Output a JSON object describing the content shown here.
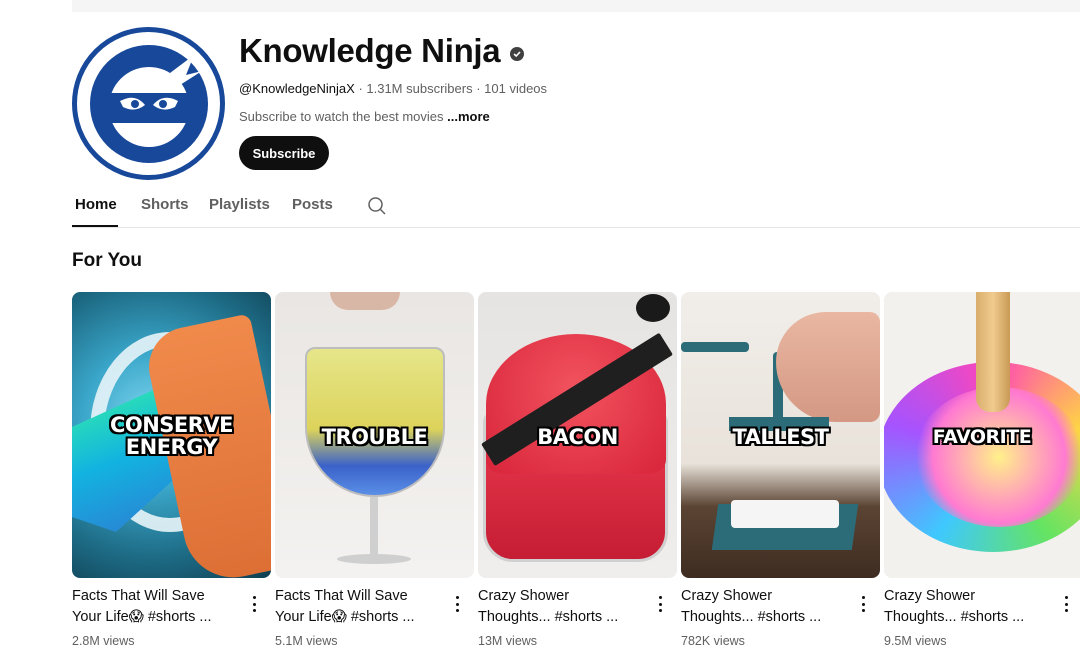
{
  "channel": {
    "name": "Knowledge Ninja",
    "handle": "@KnowledgeNinjaX",
    "stats": " · 1.31M subscribers · 101 videos",
    "description": "Subscribe to watch the best movies ",
    "more_label": "...more",
    "subscribe_label": "Subscribe",
    "brand_color": "#17489a",
    "verified_icon": "verified-check-icon"
  },
  "tabs": [
    {
      "label": "Home",
      "active": true
    },
    {
      "label": "Shorts",
      "active": false
    },
    {
      "label": "Playlists",
      "active": false
    },
    {
      "label": "Posts",
      "active": false
    }
  ],
  "section": {
    "title": "For You"
  },
  "videos": [
    {
      "thumb_text": "CONSERVE ENERGY",
      "title_line1": "Facts That Will Save",
      "title_line2": "Your Life😱 #shorts ...",
      "views": "2.8M views"
    },
    {
      "thumb_text": "TROUBLE",
      "title_line1": "Facts That Will Save",
      "title_line2": "Your Life😱 #shorts ...",
      "views": "5.1M views"
    },
    {
      "thumb_text": "BACON",
      "title_line1": "Crazy Shower",
      "title_line2": "Thoughts... #shorts ...",
      "views": "13M views"
    },
    {
      "thumb_text": "TALLEST",
      "title_line1": "Crazy Shower",
      "title_line2": "Thoughts... #shorts ...",
      "views": "782K views"
    },
    {
      "thumb_text": "FAVORITE",
      "title_line1": "Crazy Shower",
      "title_line2": "Thoughts... #shorts ...",
      "views": "9.5M views"
    }
  ]
}
